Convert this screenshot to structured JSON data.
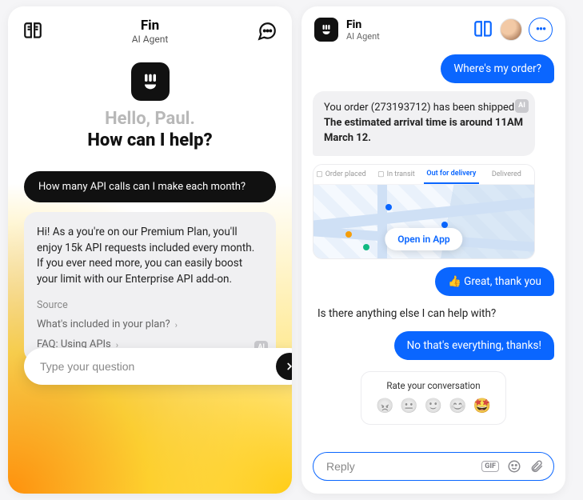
{
  "left": {
    "header": {
      "name": "Fin",
      "role": "AI Agent"
    },
    "greeting": {
      "hello": "Hello, Paul.",
      "help": "How can I help?"
    },
    "user_msg": "How many API calls can I make each month?",
    "ai_answer": "Hi! As a you're on our Premium Plan, you'll enjoy 15k API requests included every month. If you ever need more, you can easily boost your limit with our Enterprise API add-on.",
    "source_label": "Source",
    "sources": [
      "What's included in your plan?",
      "FAQ: Using APIs"
    ],
    "ai_badge": "AI",
    "input_placeholder": "Type your question"
  },
  "right": {
    "header": {
      "name": "Fin",
      "role": "AI Agent"
    },
    "msgs": {
      "u1": "Where's my order?",
      "a1_line1": "You order (273193712) has been shipped!",
      "a1_line2": "The estimated arrival time is around 11AM March 12.",
      "u2": "👍 Great, thank you",
      "a2": "Is there anything else I can help with?",
      "u3": "No that's everything, thanks!"
    },
    "ship_tabs": [
      "Order placed",
      "In transit",
      "Out for delivery",
      "Delivered"
    ],
    "ship_active_index": 2,
    "open_app": "Open in App",
    "rate_label": "Rate your conversation",
    "rate_emojis": [
      "😠",
      "😐",
      "🙂",
      "😊",
      "🤩"
    ],
    "rate_selected_index": 4,
    "reply_placeholder": "Reply",
    "ai_badge": "AI",
    "gif_label": "GIF"
  }
}
